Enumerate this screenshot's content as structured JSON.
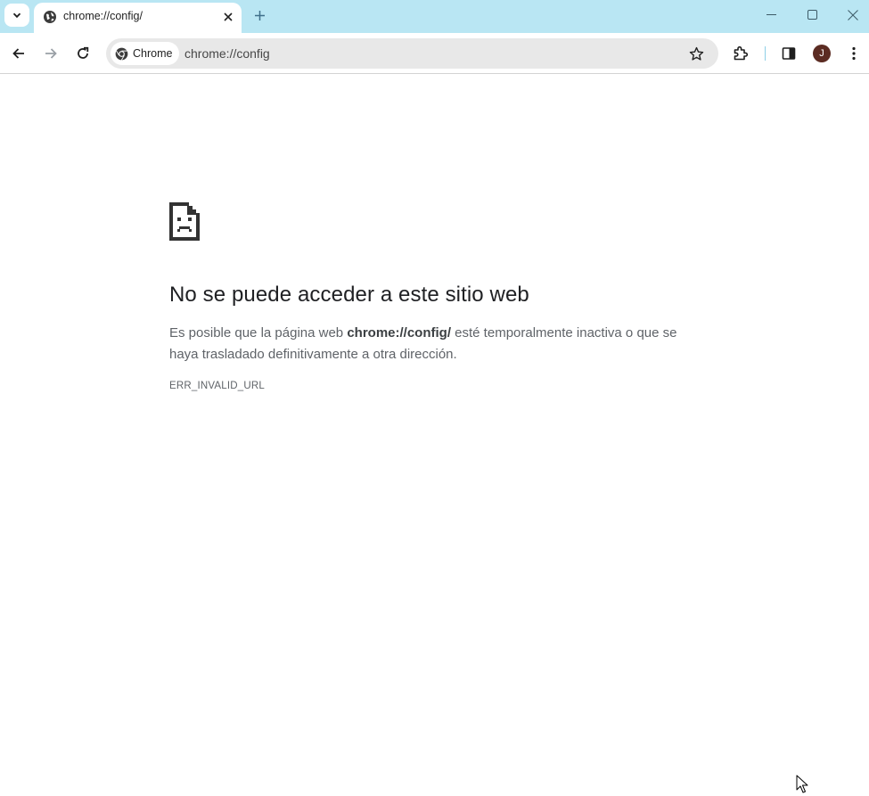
{
  "browser": {
    "tab": {
      "title": "chrome://config/"
    },
    "omnibox": {
      "chip_label": "Chrome",
      "url": "chrome://config"
    },
    "profile": {
      "initial": "J"
    }
  },
  "error_page": {
    "title": "No se puede acceder a este sitio web",
    "desc_before": "Es posible que la página web ",
    "desc_url": "chrome://config/",
    "desc_after": " esté temporalmente inactiva o que se haya trasladado definitivamente a otra dirección.",
    "error_code": "ERR_INVALID_URL"
  },
  "colors": {
    "titlebar": "#b9e6f3",
    "omnibox": "#e8e8e8",
    "avatar": "#5b2b22"
  },
  "icons": [
    "chevron-down-icon",
    "globe-icon",
    "close-icon",
    "plus-icon",
    "minimize-icon",
    "maximize-icon",
    "back-arrow-icon",
    "forward-arrow-icon",
    "reload-icon",
    "chrome-logo-icon",
    "star-icon",
    "extensions-icon",
    "side-panel-icon",
    "kebab-menu-icon",
    "sad-page-icon",
    "cursor-icon"
  ]
}
